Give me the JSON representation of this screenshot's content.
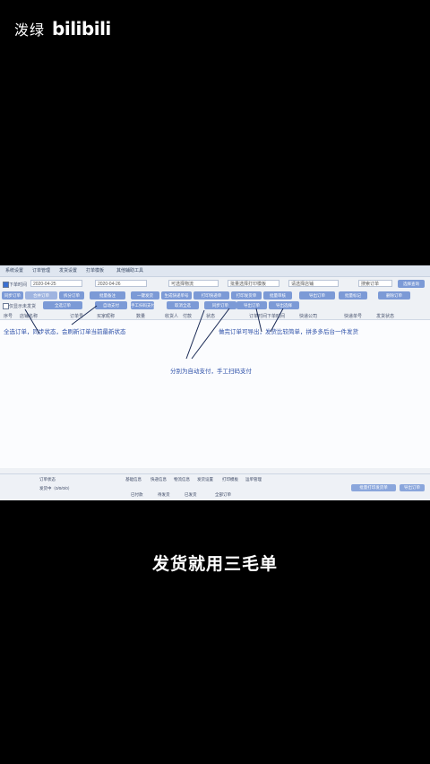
{
  "watermark": {
    "brand_cn": "泼绿",
    "brand_logo": "bilibili"
  },
  "app": {
    "menu": [
      "系统设置",
      "订单管理",
      "发货设置",
      "打单模板",
      "其他辅助工具"
    ],
    "filter_row": {
      "checkbox_label": "下单时间",
      "date_from": "2020-04-25",
      "date_to": "2020-04-26",
      "logistics": "可选择物流",
      "template": "批量选择打印模板",
      "shop": "请选择店铺",
      "search_placeholder": "搜索订单",
      "search_button": "选择查询"
    },
    "buttons_row1": [
      "同步订单",
      "合并订单",
      "拆分订单",
      "批量备注",
      "一键发货",
      "生成快递单号",
      "打印快递单",
      "打印发货单",
      "批量审核",
      "导出订单",
      "批量标记",
      "删除订单",
      "批量发货"
    ],
    "buttons_row2": [
      "全选订单",
      "自动支付",
      "手工扫码支付",
      "取消全选",
      "同步订单",
      "导出订单",
      "导出选择"
    ],
    "side_checkbox": "仅显示未发货",
    "columns": [
      "序号",
      "店铺名称",
      "订单号",
      "买家昵称",
      "数量",
      "收货人",
      "付款",
      "状态",
      "订单时间",
      "下单时间",
      "快递公司",
      "快递单号",
      "发货状态"
    ],
    "annotations": [
      "全选订单，同步状态，会刷新订单当前最新状态",
      "分别为自动支付，手工扫码支付",
      "做完订单可导出，发货比较简单，拼多多后台一件发货"
    ],
    "bottom": {
      "left_labels": [
        "订单状态",
        "发货中（0/0/0/0）"
      ],
      "tabs": [
        "基础信息",
        "快递信息",
        "物流信息",
        "发货设置",
        "打印模板",
        "运单管理"
      ],
      "options": [
        "已付款",
        "待发货",
        "已发货",
        "全部订单"
      ],
      "right_button": "批量打印发货单",
      "right_button2": "导出订单"
    }
  },
  "caption": "发货就用三毛单",
  "colors": {
    "button": "#7c9ad6",
    "annotation": "#2c4fa8",
    "window_bg": "#eef1f5"
  }
}
